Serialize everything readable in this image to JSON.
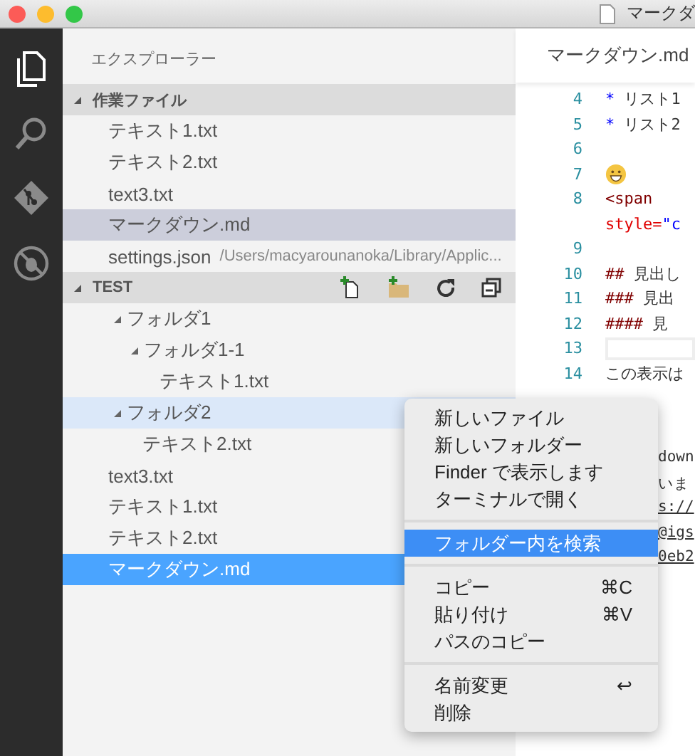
{
  "window": {
    "title": "マークダ"
  },
  "explorer": {
    "title": "エクスプローラー",
    "working_files": {
      "title": "作業ファイル",
      "expanded": true,
      "items": [
        {
          "label": "テキスト1.txt",
          "selected": false
        },
        {
          "label": "テキスト2.txt",
          "selected": false
        },
        {
          "label": "text3.txt",
          "selected": false
        },
        {
          "label": "マークダウン.md",
          "selected": true
        },
        {
          "label": "settings.json",
          "description": "/Users/macyarounanoka/Library/Applic...",
          "selected": false
        }
      ]
    },
    "project": {
      "title": "TEST",
      "expanded": true,
      "tree": [
        {
          "label": "フォルダ1",
          "expanded": true,
          "selected": false,
          "focused": false,
          "children": [
            {
              "label": "フォルダ1-1",
              "expanded": true,
              "selected": false,
              "focused": false,
              "children": [
                {
                  "label": "テキスト1.txt",
                  "selected": false,
                  "focused": false
                }
              ]
            }
          ]
        },
        {
          "label": "フォルダ2",
          "expanded": true,
          "selected": false,
          "focused": true,
          "children": [
            {
              "label": "テキスト2.txt",
              "selected": false,
              "focused": false
            }
          ]
        },
        {
          "label": "text3.txt",
          "selected": false,
          "focused": false
        },
        {
          "label": "テキスト1.txt",
          "selected": false,
          "focused": false
        },
        {
          "label": "テキスト2.txt",
          "selected": false,
          "focused": false
        },
        {
          "label": "マークダウン.md",
          "selected": true,
          "focused": false
        }
      ]
    }
  },
  "editor": {
    "tab": "マークダウン.md",
    "lines": [
      {
        "kind": "list",
        "number": "4",
        "marker": "*",
        "text": "リスト1"
      },
      {
        "kind": "list",
        "number": "5",
        "marker": "*",
        "text": "リスト2"
      },
      {
        "kind": "blank",
        "number": "6"
      },
      {
        "kind": "emoji",
        "number": "7"
      },
      {
        "kind": "tag",
        "number": "8",
        "text": "<span",
        "wrap_attr": "style=",
        "wrap_value": "\"c"
      },
      {
        "kind": "blank",
        "number": "9"
      },
      {
        "kind": "heading",
        "number": "10",
        "marker": "##",
        "text": "見出し"
      },
      {
        "kind": "heading",
        "number": "11",
        "marker": "###",
        "text": "見出"
      },
      {
        "kind": "heading",
        "number": "12",
        "marker": "####",
        "text": "見"
      },
      {
        "kind": "box",
        "number": "13"
      },
      {
        "kind": "text",
        "number": "14",
        "text": "この表示は"
      }
    ],
    "hidden_lines": [
      {
        "kind": "text",
        "text": "down"
      },
      {
        "kind": "text",
        "text": "いま"
      },
      {
        "kind": "link",
        "text": "s://"
      },
      {
        "kind": "link",
        "text": "@igs"
      },
      {
        "kind": "link",
        "text": "0eb2"
      }
    ]
  },
  "context_menu": {
    "groups": [
      [
        {
          "label": "新しいファイル",
          "selected": false
        },
        {
          "label": "新しいフォルダー",
          "selected": false
        },
        {
          "label": "Finder で表示します",
          "selected": false
        },
        {
          "label": "ターミナルで開く",
          "selected": false
        }
      ],
      [
        {
          "label": "フォルダー内を検索",
          "selected": true
        }
      ],
      [
        {
          "label": "コピー",
          "shortcut": "⌘C",
          "selected": false
        },
        {
          "label": "貼り付け",
          "shortcut": "⌘V",
          "selected": false
        },
        {
          "label": "パスのコピー",
          "selected": false
        }
      ],
      [
        {
          "label": "名前変更",
          "shortcut": "↩",
          "selected": false
        },
        {
          "label": "削除",
          "selected": false
        }
      ]
    ]
  }
}
